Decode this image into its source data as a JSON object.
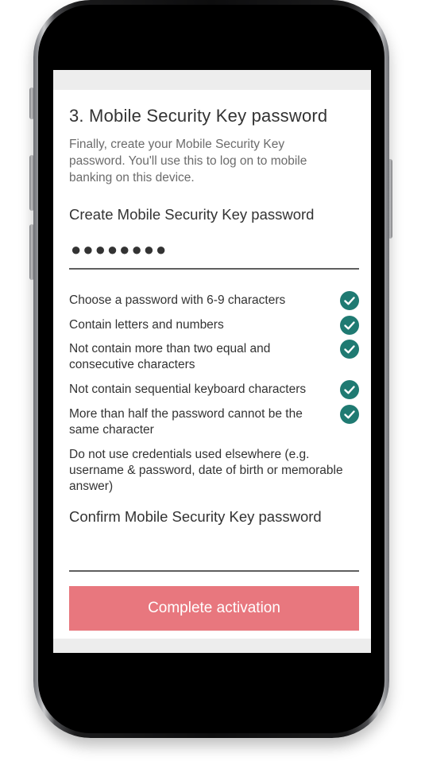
{
  "section": {
    "title": "3.  Mobile Security Key password",
    "intro": "Finally, create your Mobile Security Key password. You'll use this to log on to mobile banking on this device."
  },
  "create_field": {
    "label": "Create Mobile Security Key password",
    "masked_value": "●●●●●●●●"
  },
  "rules": [
    {
      "text": "Choose a password with 6-9 characters",
      "met": true
    },
    {
      "text": "Contain letters and numbers",
      "met": true
    },
    {
      "text": "Not contain more than two equal and consecutive characters",
      "met": true
    },
    {
      "text": "Not contain sequential keyboard characters",
      "met": true
    },
    {
      "text": "More than half the password cannot be the same character",
      "met": true
    },
    {
      "text": "Do not use credentials used elsewhere (e.g. username & password, date of birth or memorable answer)",
      "met": false
    }
  ],
  "confirm_field": {
    "label": "Confirm Mobile Security Key password",
    "value": ""
  },
  "cta": {
    "label": "Complete activation"
  },
  "colors": {
    "check": "#1f7a72",
    "cta": "#e8777e",
    "text": "#333333",
    "muted": "#6b6b6b"
  },
  "icons": {
    "check": "check-circle-icon"
  }
}
